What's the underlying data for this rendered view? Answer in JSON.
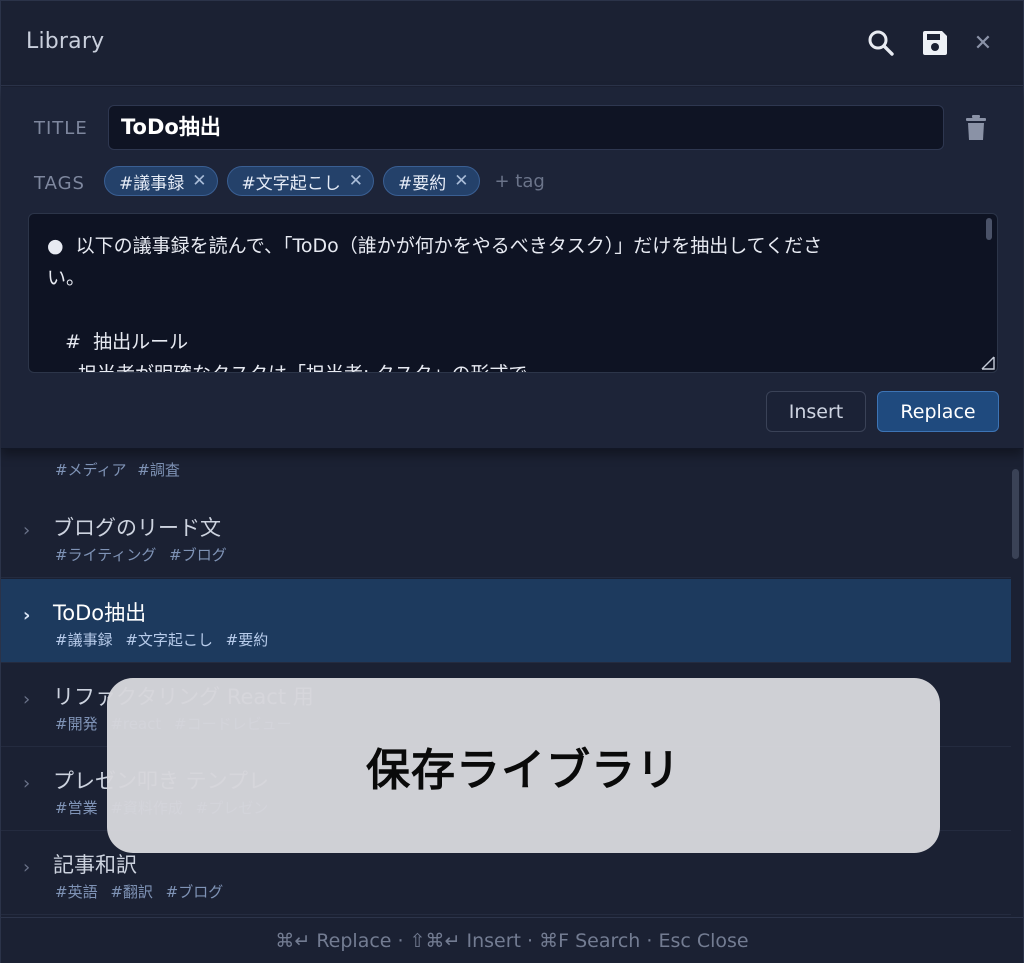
{
  "header": {
    "title": "Library"
  },
  "editor": {
    "title_label": "TITLE",
    "title_value": "ToDo抽出",
    "tags_label": "TAGS",
    "tags": [
      "#議事録",
      "#文字起こし",
      "#要約"
    ],
    "add_tag": "+ tag",
    "body_text": "●  以下の議事録を読んで、「ToDo（誰かが何かをやるべきタスク）」だけを抽出してくださ\nい。\n\n   #  抽出ルール\n   - 担当者が明確なタスクは「担当者: タスク」の形式で",
    "insert_label": "Insert",
    "replace_label": "Replace"
  },
  "list": {
    "partial_tags": "#メディア #調査",
    "items": [
      {
        "name": "ブログのリード文",
        "tags": "#ライティング #ブログ"
      },
      {
        "name": "ToDo抽出",
        "tags": "#議事録 #文字起こし #要約"
      },
      {
        "name": "リファクタリング React 用",
        "tags": "#開発 #react #コードレビュー"
      },
      {
        "name": "プレゼン叩き テンプレ",
        "tags": "#営業 #資料作成 #プレゼン"
      },
      {
        "name": "記事和訳",
        "tags": "#英語 #翻訳 #ブログ"
      }
    ]
  },
  "footer": {
    "shortcuts": "⌘↵ Replace · ⇧⌘↵ Insert · ⌘F Search · Esc Close"
  },
  "overlay": {
    "text": "保存ライブラリ"
  },
  "icons": {
    "search": "search-icon",
    "save": "floppy-disk-icon",
    "close": "close-icon",
    "trash": "trash-icon"
  },
  "colors": {
    "accent": "#1f4a7e",
    "selected_row": "#1d3a5e",
    "tag_bg": "#24416a"
  }
}
